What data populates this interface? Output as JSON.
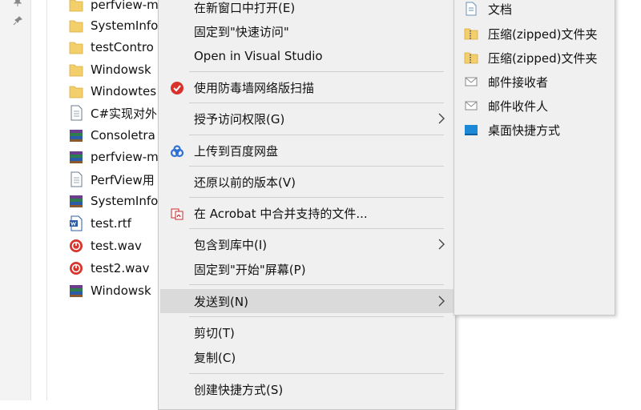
{
  "files": [
    {
      "name": "perfview-m",
      "icon": "folder-icon"
    },
    {
      "name": "SystemInfo",
      "icon": "folder-icon"
    },
    {
      "name": "testContro",
      "icon": "folder-icon"
    },
    {
      "name": "Windowsk",
      "icon": "folder-icon"
    },
    {
      "name": "Windowtes",
      "icon": "folder-icon"
    },
    {
      "name": "C#实现对外",
      "icon": "text-file-icon"
    },
    {
      "name": "Consoletra",
      "icon": "archive-icon"
    },
    {
      "name": "perfview-m",
      "icon": "archive-icon"
    },
    {
      "name": "PerfView用",
      "icon": "text-file-icon"
    },
    {
      "name": "SystemInfo",
      "icon": "archive-icon"
    },
    {
      "name": "test.rtf",
      "icon": "word-doc-icon"
    },
    {
      "name": "test.wav",
      "icon": "audio-file-icon"
    },
    {
      "name": "test2.wav",
      "icon": "audio-file-icon"
    },
    {
      "name": "Windowsk",
      "icon": "archive-icon"
    }
  ],
  "context_menu": {
    "open_new_window": "在新窗口中打开(E)",
    "pin_quick_access": "固定到\"快速访问\"",
    "open_visual_studio": "Open in Visual Studio",
    "firewall_scan": "使用防毒墙网络版扫描",
    "grant_access": "授予访问权限(G)",
    "upload_baidu": "上传到百度网盘",
    "restore_versions": "还原以前的版本(V)",
    "acrobat_combine": "在 Acrobat 中合并支持的文件...",
    "include_library": "包含到库中(I)",
    "pin_start": "固定到\"开始\"屏幕(P)",
    "send_to": "发送到(N)",
    "cut": "剪切(T)",
    "copy": "复制(C)",
    "create_shortcut": "创建快捷方式(S)"
  },
  "send_to_menu": {
    "documents": "文档",
    "compressed_1": "压缩(zipped)文件夹",
    "compressed_2": "压缩(zipped)文件夹",
    "mail_recipient_1": "邮件接收者",
    "mail_recipient_2": "邮件收件人",
    "desktop_shortcut": "桌面快捷方式"
  },
  "colors": {
    "folder": "#f2cf6b",
    "firewall": "#d9322b",
    "baidu": "#2f6fd6",
    "acrobat": "#c92a2a",
    "audio": "#d8342c",
    "desktop": "#1e88d8",
    "menu_bg": "#f0f0f0",
    "highlight": "#dadada"
  }
}
